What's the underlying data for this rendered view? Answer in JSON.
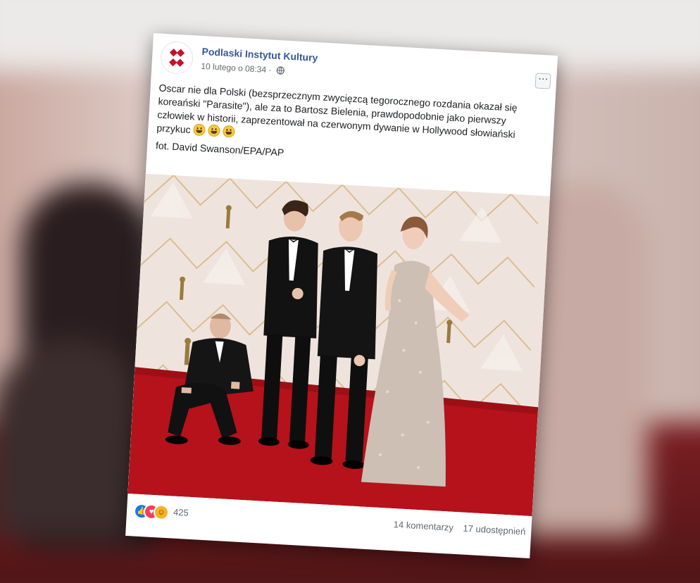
{
  "post": {
    "page_name": "Podlaski Instytut Kultury",
    "timestamp": "10 lutego o 08:34 ·",
    "more_label": "···",
    "text": "Oscar nie dla Polski (bezsprzecznym zwycięzcą tegorocznego rozdania okazał się koreański \"Parasite\"), ale za to Bartosz Bielenia, prawdopodobnie jako pierwszy człowiek w historii, zaprezentował na czerwonym dywanie w Hollywood słowiański przykuc",
    "photo_credit": "fot. David Swanson/EPA/PAP",
    "emoji_count": 3,
    "reaction_count": "425",
    "comments": "14 komentarzy",
    "shares": "17 udostępnień",
    "reaction_icons": [
      "like-icon",
      "love-icon",
      "haha-icon"
    ]
  },
  "colors": {
    "brand_link": "#385898",
    "logo_red": "#c8102e",
    "carpet": "#b5121b"
  }
}
